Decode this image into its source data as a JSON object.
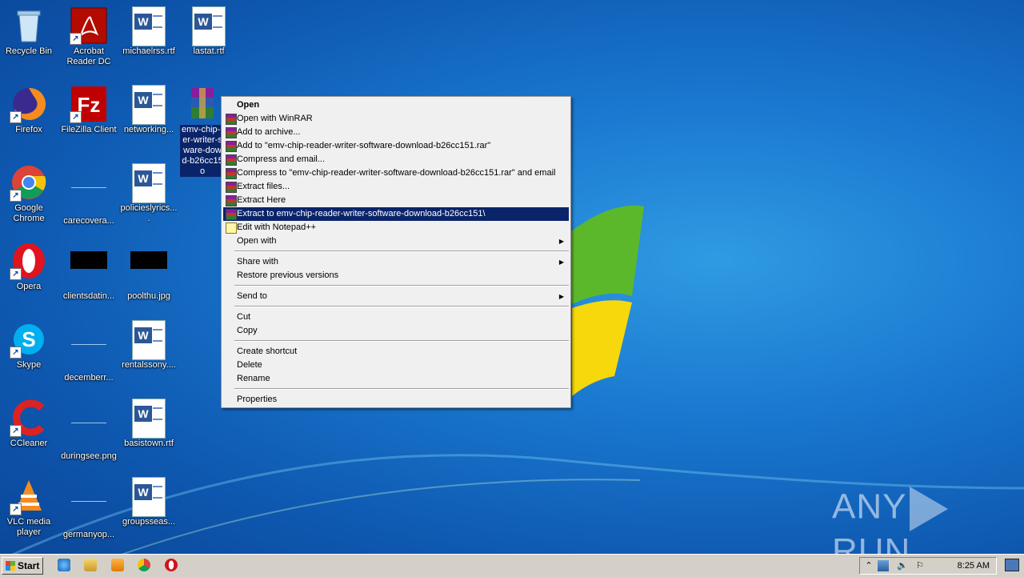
{
  "desktop": {
    "icons": [
      {
        "label": "Recycle Bin",
        "kind": "recycle-bin"
      },
      {
        "label": "Acrobat Reader DC",
        "kind": "acrobat"
      },
      {
        "label": "michaelrss.rtf",
        "kind": "word-doc"
      },
      {
        "label": "lastat.rtf",
        "kind": "word-doc"
      },
      {
        "label": "Firefox",
        "kind": "firefox"
      },
      {
        "label": "FileZilla Client",
        "kind": "filezilla"
      },
      {
        "label": "networking...",
        "kind": "word-doc"
      },
      {
        "label": "emv-chip-reader-writer-software-download-b26cc151.rar",
        "display": "emv-chip-r er-writer-s ware-dow d-b26cc15 o",
        "kind": "winrar",
        "selected": true
      },
      {
        "label": "Google Chrome",
        "kind": "chrome"
      },
      {
        "label": "carecovera...",
        "kind": "blank"
      },
      {
        "label": "policieslyrics....",
        "kind": "word-doc"
      },
      {
        "label": "Opera",
        "kind": "opera"
      },
      {
        "label": "clientsdatin...",
        "kind": "black-image"
      },
      {
        "label": "poolthu.jpg",
        "kind": "black-image"
      },
      {
        "label": "Skype",
        "kind": "skype"
      },
      {
        "label": "decemberr...",
        "kind": "blank"
      },
      {
        "label": "rentalssony....",
        "kind": "word-doc"
      },
      {
        "label": "CCleaner",
        "kind": "ccleaner"
      },
      {
        "label": "duringsee.png",
        "kind": "blank"
      },
      {
        "label": "basistown.rtf",
        "kind": "word-doc"
      },
      {
        "label": "VLC media player",
        "kind": "vlc"
      },
      {
        "label": "germanyop...",
        "kind": "blank"
      },
      {
        "label": "groupsseas...",
        "kind": "word-doc"
      }
    ]
  },
  "context_menu": {
    "items": [
      {
        "label": "Open",
        "bold": true
      },
      {
        "label": "Open with WinRAR",
        "icon": "winrar-icon"
      },
      {
        "label": "Add to archive...",
        "icon": "winrar-icon"
      },
      {
        "label": "Add to \"emv-chip-reader-writer-software-download-b26cc151.rar\"",
        "icon": "winrar-icon"
      },
      {
        "label": "Compress and email...",
        "icon": "winrar-icon"
      },
      {
        "label": "Compress to \"emv-chip-reader-writer-software-download-b26cc151.rar\" and email",
        "icon": "winrar-icon"
      },
      {
        "label": "Extract files...",
        "icon": "winrar-icon"
      },
      {
        "label": "Extract Here",
        "icon": "winrar-icon"
      },
      {
        "label": "Extract to emv-chip-reader-writer-software-download-b26cc151\\",
        "icon": "winrar-icon",
        "highlighted": true
      },
      {
        "label": "Edit with Notepad++",
        "icon": "notepadpp-icon"
      },
      {
        "label": "Open with",
        "submenu": true
      },
      {
        "label": "Share with",
        "submenu": true
      },
      {
        "label": "Restore previous versions"
      },
      {
        "label": "Send to",
        "submenu": true
      },
      {
        "label": "Cut"
      },
      {
        "label": "Copy"
      },
      {
        "label": "Create shortcut"
      },
      {
        "label": "Delete"
      },
      {
        "label": "Rename"
      },
      {
        "label": "Properties"
      }
    ]
  },
  "taskbar": {
    "start_label": "Start",
    "quick_launch": [
      "internet-explorer-icon",
      "explorer-icon",
      "media-player-icon",
      "chrome-icon",
      "opera-icon"
    ],
    "tray_icons": [
      "show-hidden-icons-icon",
      "network-icon",
      "volume-icon",
      "action-center-flag-icon"
    ],
    "clock": "8:25 AM"
  },
  "watermark": {
    "left": "ANY",
    "right": "RUN"
  },
  "colors": {
    "menu_highlight": "#0a246a",
    "taskbar": "#d4d0c8"
  }
}
